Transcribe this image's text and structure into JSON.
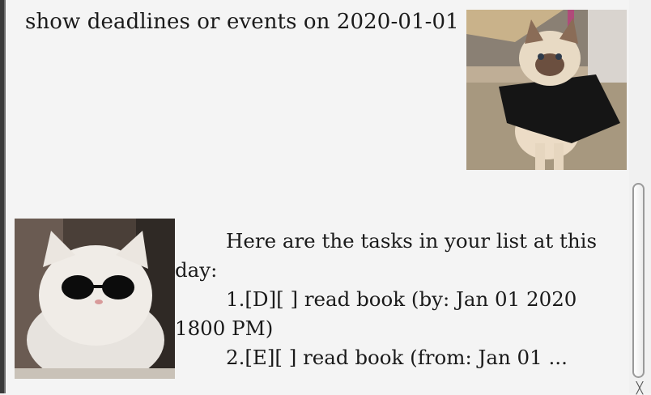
{
  "conversation": {
    "user_message": "show deadlines or events on 2020-01-01",
    "bot_message": {
      "lines": [
        "Here are the tasks in your list at this",
        "day:",
        "1.[D][ ]  read book  (by: Jan 01 2020",
        "1800 PM)",
        "2.[E][ ]  read book  (from: Jan 01 ..."
      ]
    }
  },
  "avatars": {
    "user": "cat-in-cape-photo",
    "bot": "cat-with-sunglasses-photo"
  },
  "scrollbar": {
    "down_arrow_icon": "chevron-down-icon",
    "down_arrow_glyph": "╳"
  }
}
